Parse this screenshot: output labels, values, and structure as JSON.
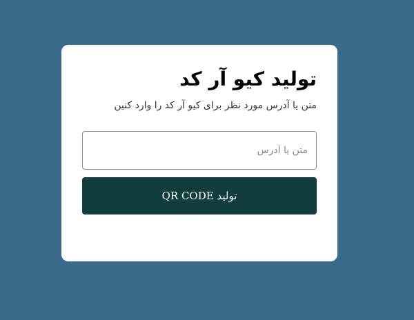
{
  "card": {
    "title": "تولید کیو آر کد",
    "subtitle": "متن یا آدرس مورد نظر برای کیو آر کد را وارد کنین",
    "input": {
      "placeholder": "متن یا آدرس",
      "value": ""
    },
    "generate_button_label": "تولید QR CODE"
  },
  "colors": {
    "page_background": "#396a89",
    "card_background": "#ffffff",
    "button_background": "#113d3c",
    "button_text": "#ffffff",
    "input_border": "#8e8e8e"
  }
}
